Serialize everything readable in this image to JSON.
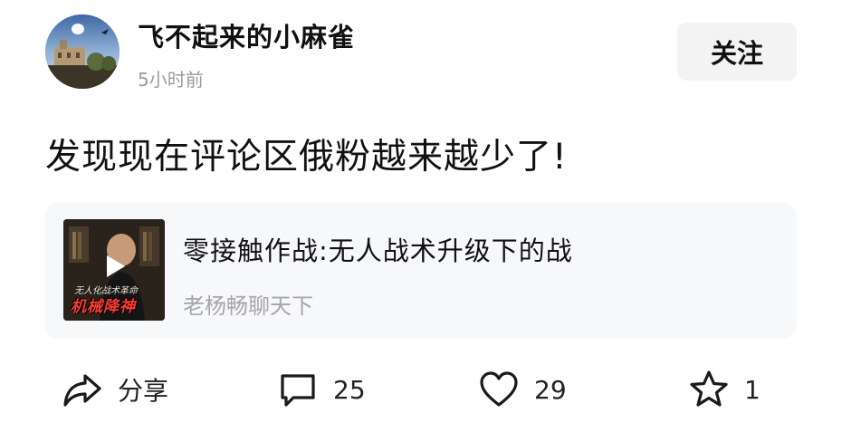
{
  "author": {
    "name": "飞不起来的小麻雀",
    "time": "5小时前",
    "follow_label": "关注"
  },
  "post": {
    "text": "发现现在评论区俄粉越来越少了!"
  },
  "video_card": {
    "title": "零接触作战:无人战术升级下的战",
    "author": "老杨畅聊天下",
    "thumb_caption": "机械降神",
    "thumb_subcaption": "无人化战术革命"
  },
  "actions": {
    "share": {
      "icon": "share-icon",
      "label": "分享"
    },
    "comment": {
      "icon": "comment-icon",
      "count": "25"
    },
    "like": {
      "icon": "heart-icon",
      "count": "29"
    },
    "favorite": {
      "icon": "star-icon",
      "count": "1"
    }
  },
  "colors": {
    "text_primary": "#111111",
    "text_secondary": "#9b9b9b",
    "follow_bg": "#f3f3f3",
    "card_bg": "#f7f8fa"
  }
}
